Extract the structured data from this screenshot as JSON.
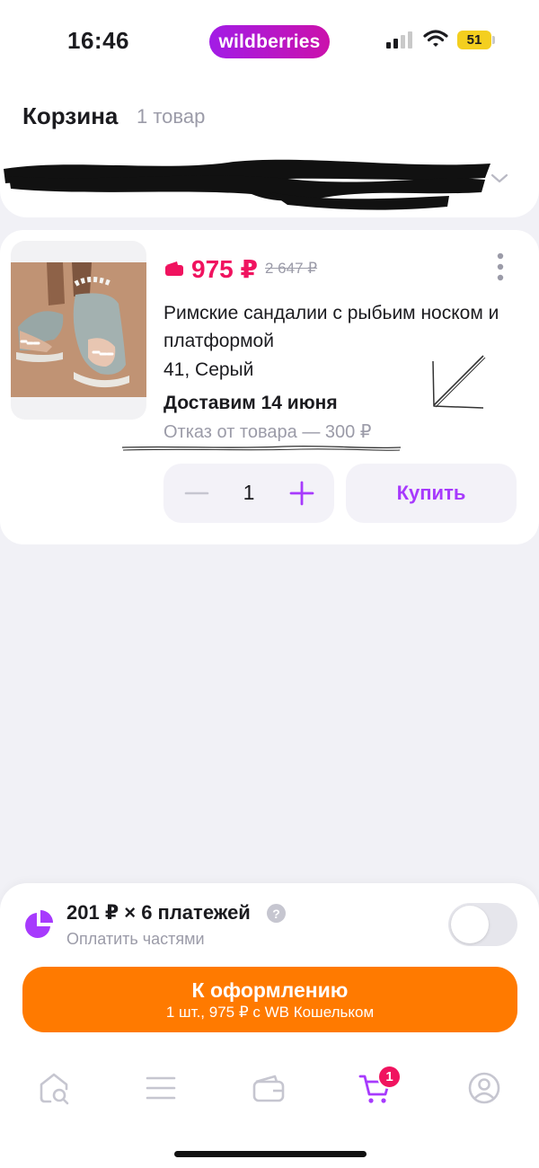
{
  "status_bar": {
    "time": "16:46",
    "brand": "wildberries",
    "battery": "51"
  },
  "header": {
    "title": "Корзина",
    "count": "1 товар"
  },
  "product": {
    "price": "975 ₽",
    "old_price": "2 647 ₽",
    "name": "Римские сандалии с рыбьим носком и платформой",
    "variant": "41, Серый",
    "delivery": "Доставим 14 июня",
    "refusal": "Отказ от товара — 300 ₽",
    "quantity": "1",
    "buy_label": "Купить"
  },
  "installment": {
    "main": "201 ₽ × 6 платежей",
    "help": "?",
    "sub": "Оплатить частями",
    "enabled": false
  },
  "checkout": {
    "title": "К оформлению",
    "subtitle": "1 шт., 975 ₽ с WB Кошельком"
  },
  "tab_bar": {
    "cart_badge": "1",
    "items": [
      "home-icon",
      "menu-icon",
      "wallet-icon",
      "cart-icon",
      "profile-icon"
    ]
  },
  "colors": {
    "brand_gradient_start": "#a21ce6",
    "brand_gradient_end": "#cb11ab",
    "price": "#f0135f",
    "accent_purple": "#a73afd",
    "checkout_orange": "#ff7a00",
    "muted": "#9b9ba8"
  }
}
